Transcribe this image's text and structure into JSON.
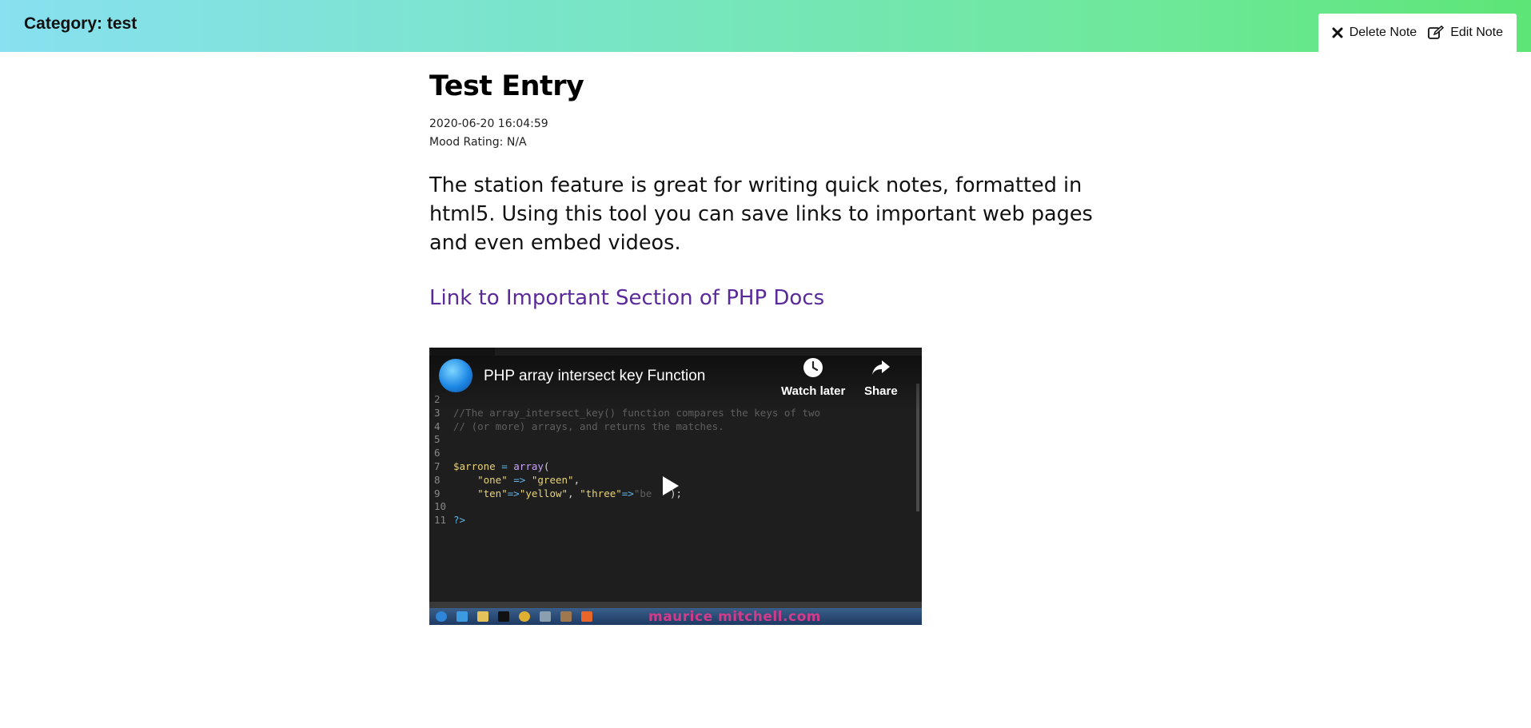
{
  "header": {
    "category": "Category: test",
    "delete_label": "Delete Note",
    "edit_label": "Edit Note"
  },
  "note": {
    "title": "Test Entry",
    "timestamp": "2020-06-20 16:04:59",
    "mood": "Mood Rating: N/A",
    "body": "The station feature is great for writing quick notes, formatted in html5. Using this tool you can save links to important web pages and even embed videos.",
    "link_text": "Link to Important Section of PHP Docs"
  },
  "video": {
    "title": "PHP array intersect key Function",
    "watch_later_label": "Watch later",
    "share_label": "Share",
    "watermark": "maurice mitchell.com"
  },
  "colors": {
    "link": "#5a2a9a",
    "gradient_start": "#88e0f0",
    "gradient_end": "#5de577"
  },
  "icons": {
    "delete": "close-x-icon",
    "edit": "edit-pencil-icon",
    "watch_later": "clock-icon",
    "share": "share-arrow-icon",
    "play": "play-icon"
  }
}
